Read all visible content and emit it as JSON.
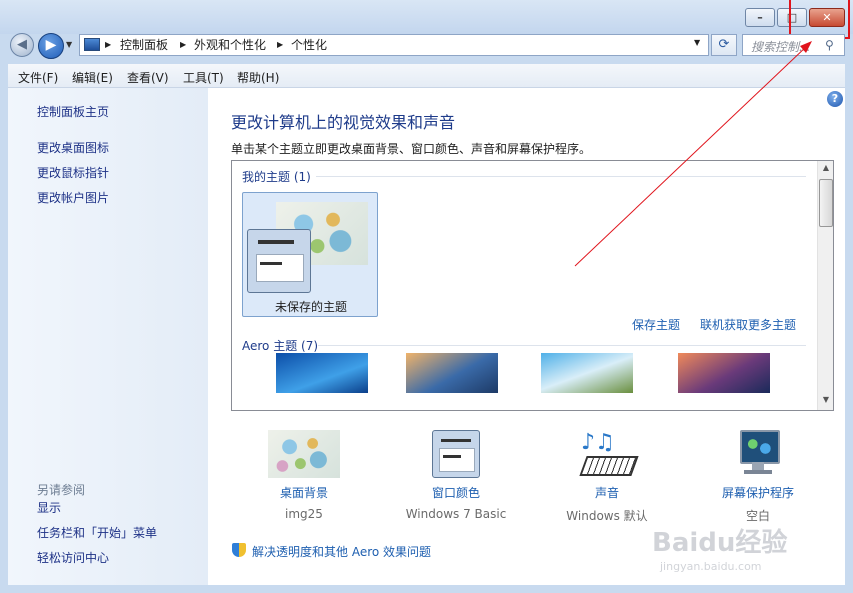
{
  "window": {
    "minimize_label": "–",
    "maximize_label": "□",
    "close_label": "✕"
  },
  "nav": {
    "back_icon": "back-arrow-icon",
    "forward_icon": "forward-arrow-icon",
    "breadcrumbs": [
      "控制面板",
      "外观和个性化",
      "个性化"
    ],
    "search_placeholder": "搜索控制..."
  },
  "menu": [
    "文件(F)",
    "编辑(E)",
    "查看(V)",
    "工具(T)",
    "帮助(H)"
  ],
  "sidebar": {
    "home": "控制面板主页",
    "links": [
      "更改桌面图标",
      "更改鼠标指针",
      "更改帐户图片"
    ],
    "see_also_title": "另请参阅",
    "see_also": [
      "显示",
      "任务栏和「开始」菜单",
      "轻松访问中心"
    ]
  },
  "main": {
    "title": "更改计算机上的视觉效果和声音",
    "description": "单击某个主题立即更改桌面背景、窗口颜色、声音和屏幕保护程序。",
    "my_themes_label": "我的主题 (1)",
    "unsaved_theme": "未保存的主题",
    "save_theme": "保存主题",
    "get_more_themes": "联机获取更多主题",
    "aero_themes_label": "Aero 主题 (7)",
    "bottom": [
      {
        "title": "桌面背景",
        "value": "img25",
        "icon": "desktop-background-icon"
      },
      {
        "title": "窗口颜色",
        "value": "Windows 7 Basic",
        "icon": "window-color-icon"
      },
      {
        "title": "声音",
        "value": "Windows 默认",
        "icon": "sounds-icon"
      },
      {
        "title": "屏幕保护程序",
        "value": "空白",
        "icon": "screensaver-icon"
      }
    ],
    "troubleshoot": "解决透明度和其他 Aero 效果问题",
    "help": "?"
  },
  "watermark": {
    "brand": "Baidu经验",
    "url": "jingyan.baidu.com"
  },
  "colors": {
    "link": "#1e5fb0",
    "title": "#1e3b8a",
    "annotation": "#e0141c"
  }
}
